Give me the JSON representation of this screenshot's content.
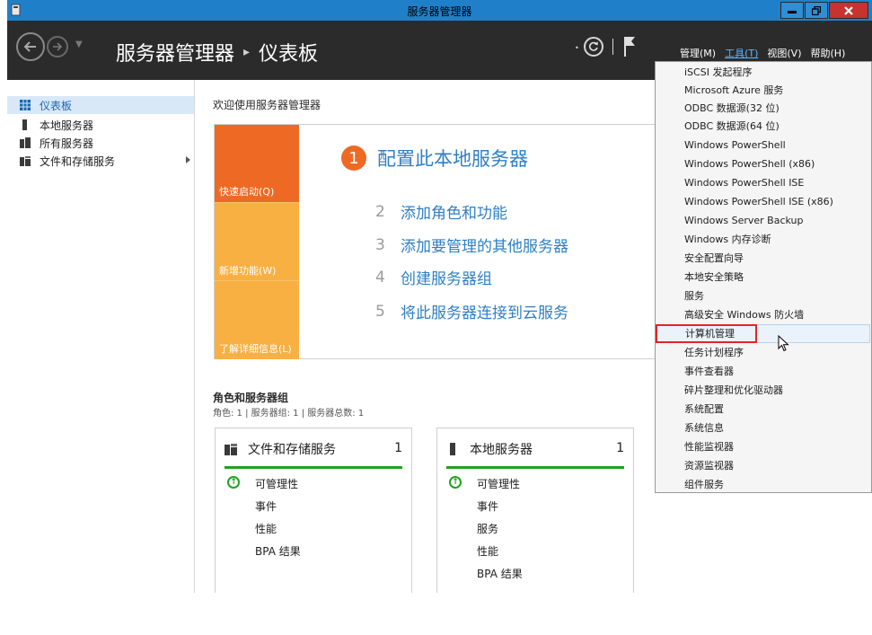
{
  "window": {
    "title": "服务器管理器",
    "controls": {
      "minimize": "▬",
      "maximize": "🗗",
      "close": "✕"
    }
  },
  "header": {
    "breadcrumb_root": "服务器管理器",
    "breadcrumb_separator": "▸",
    "breadcrumb_current": "仪表板",
    "menus": [
      {
        "label": "管理(M)"
      },
      {
        "label": "工具(T)",
        "active": true
      },
      {
        "label": "视图(V)"
      },
      {
        "label": "帮助(H)"
      }
    ]
  },
  "sidebar": {
    "items": [
      {
        "label": "仪表板",
        "icon": "dashboard-icon",
        "selected": true
      },
      {
        "label": "本地服务器",
        "icon": "server-icon"
      },
      {
        "label": "所有服务器",
        "icon": "servers-icon"
      },
      {
        "label": "文件和存储服务",
        "icon": "file-storage-icon",
        "has_submenu": true
      }
    ]
  },
  "main": {
    "welcome_heading": "欢迎使用服务器管理器",
    "tiles": {
      "quick_start": "快速启动(Q)",
      "whats_new": "新增功能(W)",
      "learn_more": "了解详细信息(L)"
    },
    "steps": [
      {
        "num": "1",
        "label": "配置此本地服务器"
      },
      {
        "num": "2",
        "label": "添加角色和功能"
      },
      {
        "num": "3",
        "label": "添加要管理的其他服务器"
      },
      {
        "num": "4",
        "label": "创建服务器组"
      },
      {
        "num": "5",
        "label": "将此服务器连接到云服务"
      }
    ],
    "roles_title": "角色和服务器组",
    "roles_summary": "角色: 1 | 服务器组: 1 | 服务器总数: 1",
    "role_tiles": [
      {
        "title": "文件和存储服务",
        "count": "1",
        "rows": [
          "可管理性",
          "事件",
          "性能",
          "BPA 结果"
        ]
      },
      {
        "title": "本地服务器",
        "count": "1",
        "rows": [
          "可管理性",
          "事件",
          "服务",
          "性能",
          "BPA 结果"
        ]
      }
    ]
  },
  "tools_menu": {
    "items": [
      "iSCSI 发起程序",
      "Microsoft Azure 服务",
      "ODBC 数据源(32 位)",
      "ODBC 数据源(64 位)",
      "Windows PowerShell",
      "Windows PowerShell (x86)",
      "Windows PowerShell ISE",
      "Windows PowerShell ISE (x86)",
      "Windows Server Backup",
      "Windows 内存诊断",
      "安全配置向导",
      "本地安全策略",
      "服务",
      "高级安全 Windows 防火墙",
      "计算机管理",
      "任务计划程序",
      "事件查看器",
      "碎片整理和优化驱动器",
      "系统配置",
      "系统信息",
      "性能监视器",
      "资源监视器",
      "组件服务"
    ],
    "hovered": "计算机管理"
  },
  "colors": {
    "titlebar": "#1f80c9",
    "header": "#2b2b2b",
    "quick_start_tile": "#ee6a24",
    "secondary_tile": "#f8b043",
    "link": "#2f7fc4",
    "status_green": "#1ea21e",
    "highlight_box": "#e2262a"
  }
}
